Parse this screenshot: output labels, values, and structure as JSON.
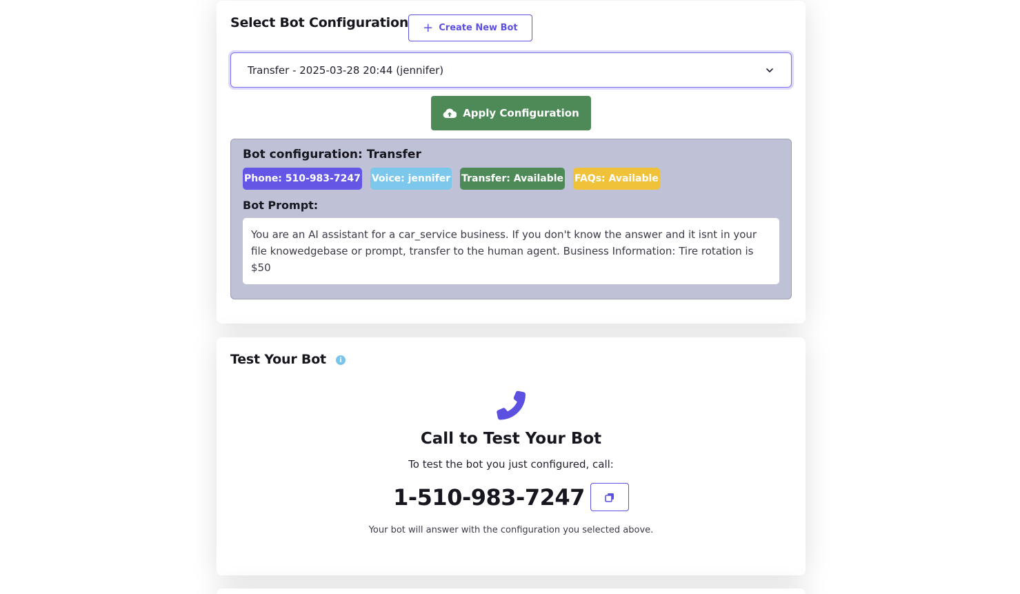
{
  "config_section": {
    "title": "Select Bot Configuration",
    "create_button_label": "Create New Bot",
    "selected_config": "Transfer - 2025-03-28 20:44 (jennifer)",
    "apply_button_label": "Apply Configuration",
    "panel": {
      "title": "Bot configuration: Transfer",
      "badges": [
        {
          "label": "Phone: 510-983-7247",
          "color": "#6457e6"
        },
        {
          "label": "Voice: jennifer",
          "color": "#7cc8ec"
        },
        {
          "label": "Transfer: Available",
          "color": "#4e8a58"
        },
        {
          "label": "FAQs: Available",
          "color": "#efc23a"
        }
      ],
      "prompt_label": "Bot Prompt:",
      "prompt_text": "You are an AI assistant for a car_service business. If you don't know the answer and it isnt in your file knowedgebase or prompt, transfer to the human agent. Business Information: Tire rotation is $50"
    }
  },
  "test_section": {
    "title": "Test Your Bot",
    "call_title": "Call to Test Your Bot",
    "call_instruction": "To test the bot you just configured, call:",
    "phone_number": "1-510-983-7247",
    "footer_note": "Your bot will answer with the configuration you selected above."
  },
  "colors": {
    "accent": "#5b50e0",
    "apply_green": "#4e8a58",
    "panel_bg": "#bfc2d6"
  },
  "icons": [
    "plus-icon",
    "chevron-down-icon",
    "cloud-upload-icon",
    "info-icon",
    "phone-icon",
    "copy-icon"
  ]
}
